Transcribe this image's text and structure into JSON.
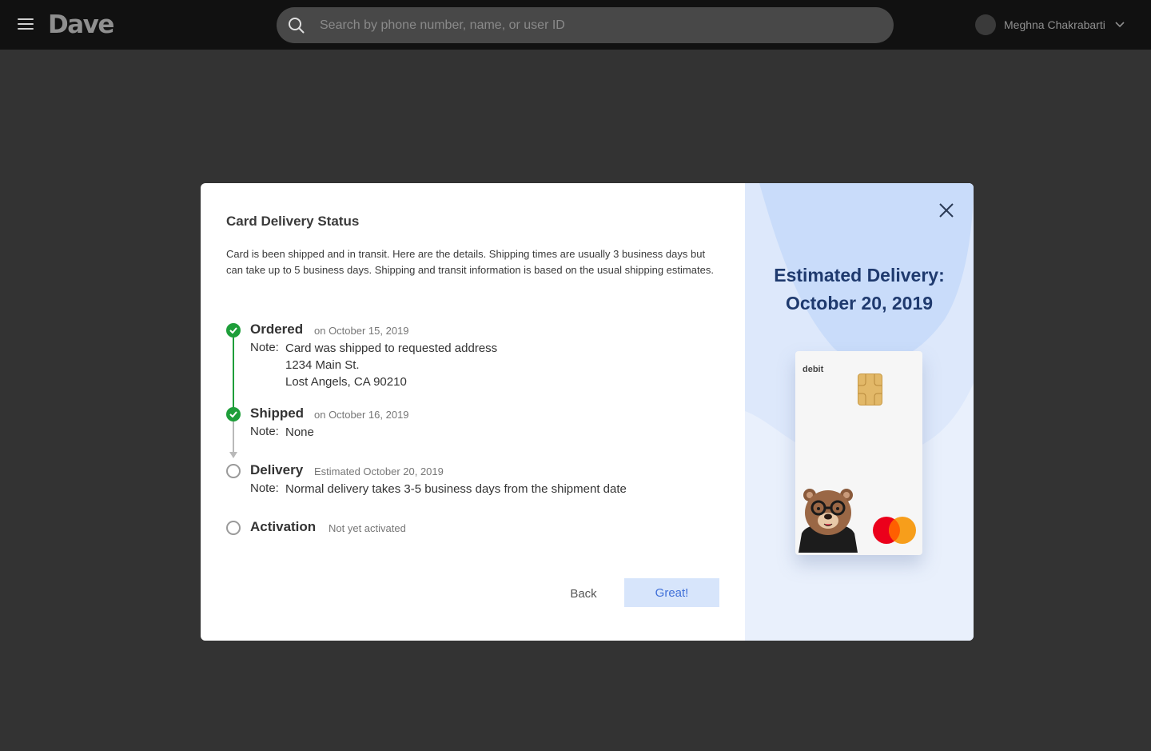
{
  "app": {
    "logo": "Dave",
    "search_placeholder": "Search by phone number, name, or user ID",
    "user_name": "Meghna Chakrabarti"
  },
  "modal": {
    "title": "Card Delivery Status",
    "description": "Card is been shipped and in transit. Here are the details. Shipping times are usually 3 business days but can take up to 5 business days. Shipping and transit information is based on the usual shipping estimates.",
    "steps": [
      {
        "title": "Ordered",
        "meta": "on October 15, 2019",
        "status": "complete",
        "note_label": "Note:",
        "note_lines": [
          "Card was shipped to requested address",
          "1234 Main St.",
          "Lost Angels, CA 90210"
        ]
      },
      {
        "title": "Shipped",
        "meta": "on October 16, 2019",
        "status": "complete",
        "note_label": "Note:",
        "note_lines": [
          "None"
        ]
      },
      {
        "title": "Delivery",
        "meta": "Estimated October 20, 2019",
        "status": "pending",
        "note_label": "Note:",
        "note_lines": [
          "Normal delivery takes 3-5 business days from the shipment date"
        ]
      },
      {
        "title": "Activation",
        "meta": "Not yet activated",
        "status": "pending"
      }
    ],
    "back_label": "Back",
    "confirm_label": "Great!",
    "estimated_label": "Estimated Delivery:",
    "estimated_date": "October 20, 2019",
    "card_type": "debit"
  },
  "colors": {
    "topbar": "#111111",
    "overlay": "#333333",
    "complete": "#1e9e3a",
    "accent": "#3f6fd8",
    "heading_navy": "#1f3a6e"
  },
  "icons": [
    "menu-icon",
    "search-icon",
    "chevron-down-icon",
    "check-icon",
    "close-icon",
    "chip-icon",
    "bear-mascot",
    "mastercard-logo"
  ]
}
